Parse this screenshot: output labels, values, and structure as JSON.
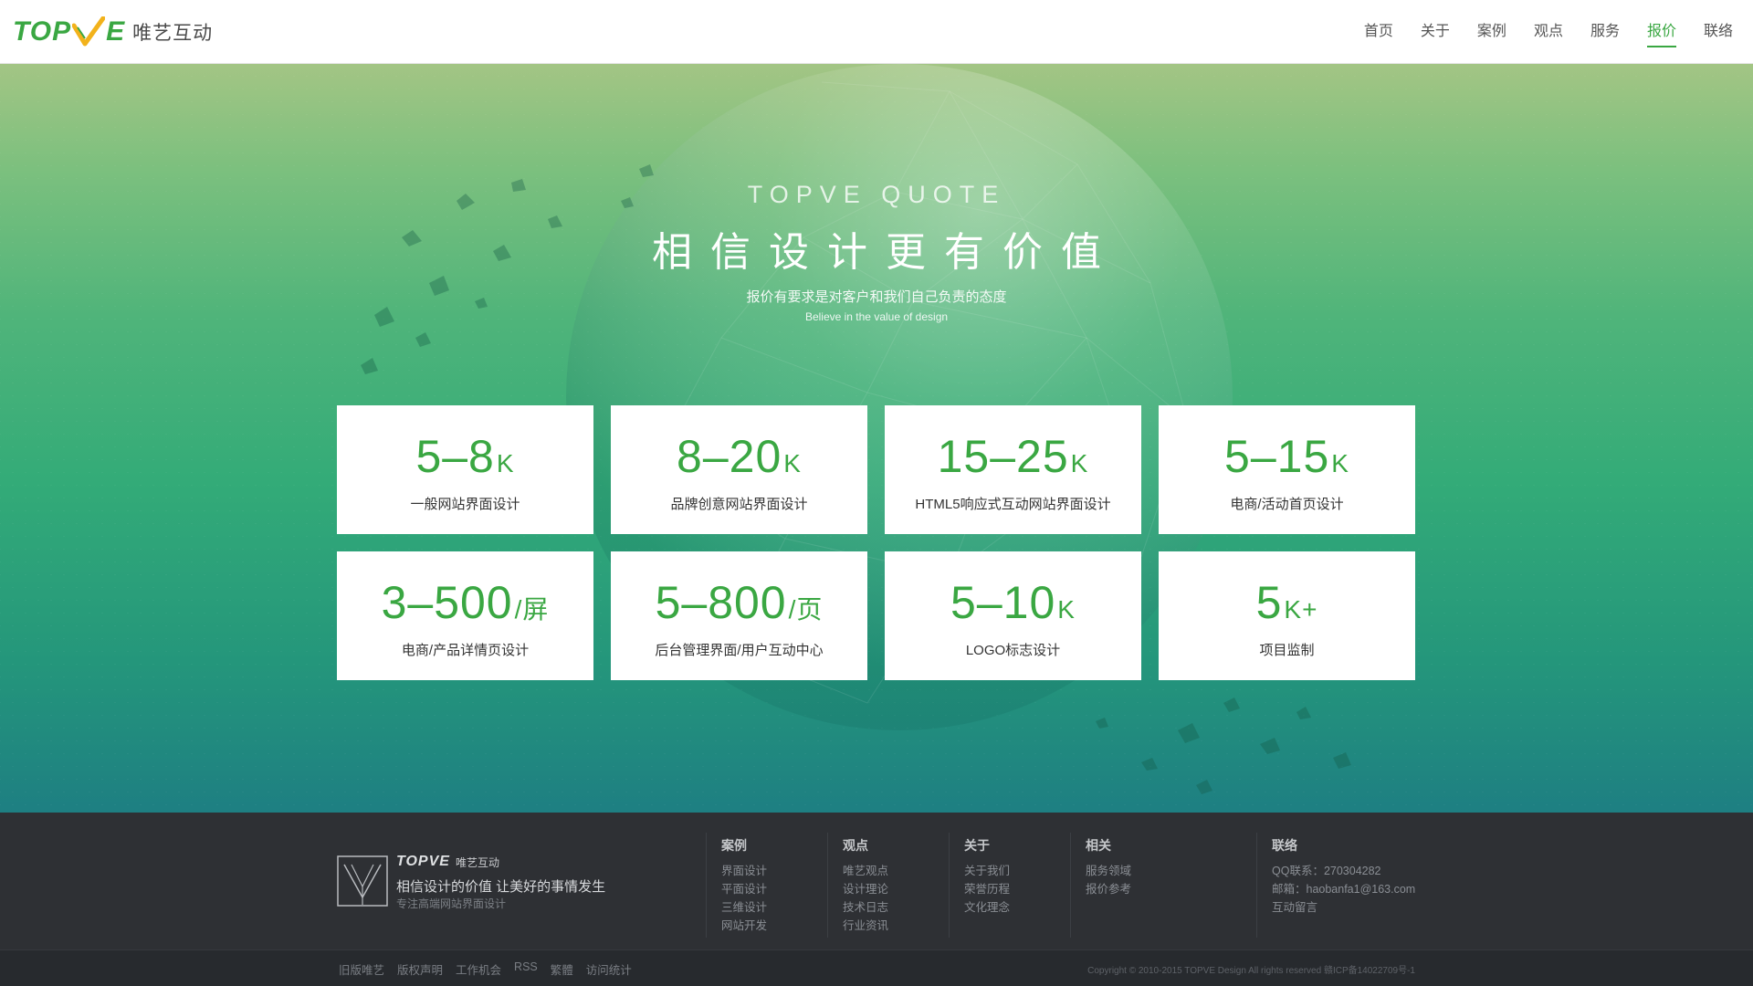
{
  "header": {
    "logo_text_left": "TOP",
    "logo_text_right": "E",
    "logo_cn": "唯艺互动",
    "nav": [
      {
        "label": "首页",
        "active": false
      },
      {
        "label": "关于",
        "active": false
      },
      {
        "label": "案例",
        "active": false
      },
      {
        "label": "观点",
        "active": false
      },
      {
        "label": "服务",
        "active": false
      },
      {
        "label": "报价",
        "active": true
      },
      {
        "label": "联络",
        "active": false
      }
    ]
  },
  "hero": {
    "eyebrow": "TOPVE QUOTE",
    "title": "相信设计更有价值",
    "subtitle": "报价有要求是对客户和我们自己负责的态度",
    "subtitle_en": "Believe in the value of design"
  },
  "cards": [
    {
      "price": "5–8",
      "unit": "K",
      "label": "一般网站界面设计"
    },
    {
      "price": "8–20",
      "unit": "K",
      "label": "品牌创意网站界面设计"
    },
    {
      "price": "15–25",
      "unit": "K",
      "label": "HTML5响应式互动网站界面设计"
    },
    {
      "price": "5–15",
      "unit": "K",
      "label": "电商/活动首页设计"
    },
    {
      "price": "3–500",
      "unit": "/屏",
      "label": "电商/产品详情页设计"
    },
    {
      "price": "5–800",
      "unit": "/页",
      "label": "后台管理界面/用户互动中心"
    },
    {
      "price": "5–10",
      "unit": "K",
      "label": "LOGO标志设计"
    },
    {
      "price": "5",
      "unit": "K+",
      "label": "项目监制"
    }
  ],
  "footer": {
    "brand_word": "TOPVE",
    "brand_cn": "唯艺互动",
    "slogan": "相信设计的价值 让美好的事情发生",
    "slogan_sub": "专注高端网站界面设计",
    "columns": [
      {
        "title": "案例",
        "links": [
          "界面设计",
          "平面设计",
          "三维设计",
          "网站开发"
        ]
      },
      {
        "title": "观点",
        "links": [
          "唯艺观点",
          "设计理论",
          "技术日志",
          "行业资讯"
        ]
      },
      {
        "title": "关于",
        "links": [
          "关于我们",
          "荣誉历程",
          "文化理念"
        ]
      },
      {
        "title": "相关",
        "links": [
          "服务领域",
          "报价参考"
        ]
      },
      {
        "title": "联络",
        "links": [
          "QQ联系：270304282",
          "邮箱：haobanfa1@163.com",
          "互动留言"
        ]
      }
    ],
    "bottom_links": [
      "旧版唯艺",
      "版权声明",
      "工作机会",
      "RSS",
      "繁體",
      "访问统计"
    ],
    "copyright": "Copyright © 2010-2015 TOPVE Design All rights reserved 赣ICP备14022709号-1"
  }
}
